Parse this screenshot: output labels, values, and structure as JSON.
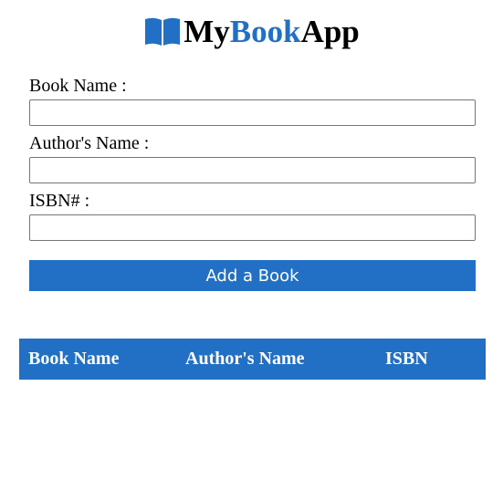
{
  "header": {
    "logo_part1": "My",
    "logo_part2": "Book",
    "logo_part3": "App",
    "icon": "open-book-icon",
    "accent_color": "#2170c6"
  },
  "form": {
    "book_name_label": "Book Name :",
    "book_name_value": "",
    "author_label": "Author's Name :",
    "author_value": "",
    "isbn_label": "ISBN# :",
    "isbn_value": "",
    "submit_label": "Add a Book"
  },
  "table": {
    "columns": [
      "Book Name",
      "Author's Name",
      "ISBN"
    ],
    "rows": []
  }
}
